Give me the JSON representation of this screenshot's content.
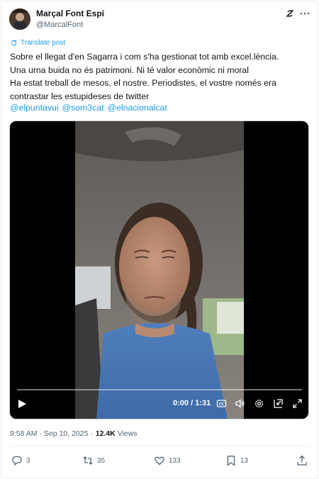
{
  "post": {
    "author_name": "Marçal Font Espí",
    "author_handle": "@MarcalFont",
    "translate_label": "Translate post",
    "text_lines": [
      "Sobre el llegat d'en Sagarra i com s'ha gestionat tot amb excel.lència.",
      "Una urna buida no és patrimoni. Ni té valor econòmic ni moral",
      "Ha estat treball de mesos, el nostre. Periodistes, el vostre només era",
      "contrastar les estupideses de twitter"
    ],
    "mentions": [
      "@elpuntavui",
      "@som3cat",
      "@elnacionalcat"
    ],
    "timestamp": "9:58 AM · Sep 10, 2025 ·",
    "views_count": "12.4K",
    "views_label": "Views"
  },
  "video": {
    "time": "0:00 / 1:31",
    "progress_fraction": 0.0
  },
  "actions": {
    "replies": "3",
    "reposts": "35",
    "likes": "133",
    "bookmarks": "13"
  },
  "colors": {
    "accent": "#1d9bf0",
    "text": "#0f1419",
    "muted": "#536471"
  },
  "icons": [
    "grok-icon",
    "more-icon",
    "translate-icon",
    "play-icon",
    "captions-icon",
    "volume-icon",
    "settings-icon",
    "pip-icon",
    "fullscreen-icon",
    "reply-icon",
    "repost-icon",
    "like-icon",
    "bookmark-icon",
    "share-icon"
  ]
}
